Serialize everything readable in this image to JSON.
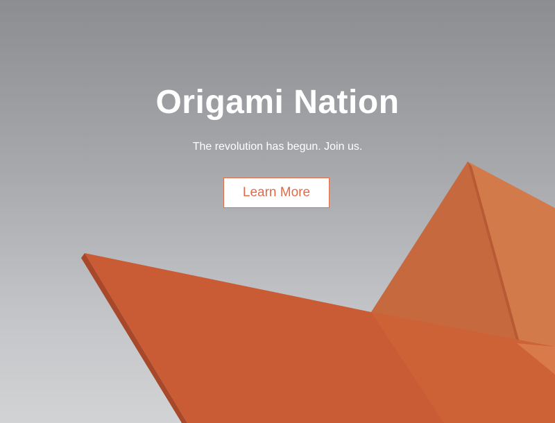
{
  "hero": {
    "title": "Origami Nation",
    "subtitle": "The revolution has begun. Join us.",
    "cta_label": "Learn More",
    "image_subject": "orange paper origami boat"
  },
  "colors": {
    "accent": "#e06b4a",
    "background_top": "#8c8d91",
    "background_bottom": "#d2d3d5",
    "origami_light": "#cf7042",
    "origami_mid": "#c85d37",
    "origami_dark": "#b84d2c",
    "text": "#ffffff"
  }
}
